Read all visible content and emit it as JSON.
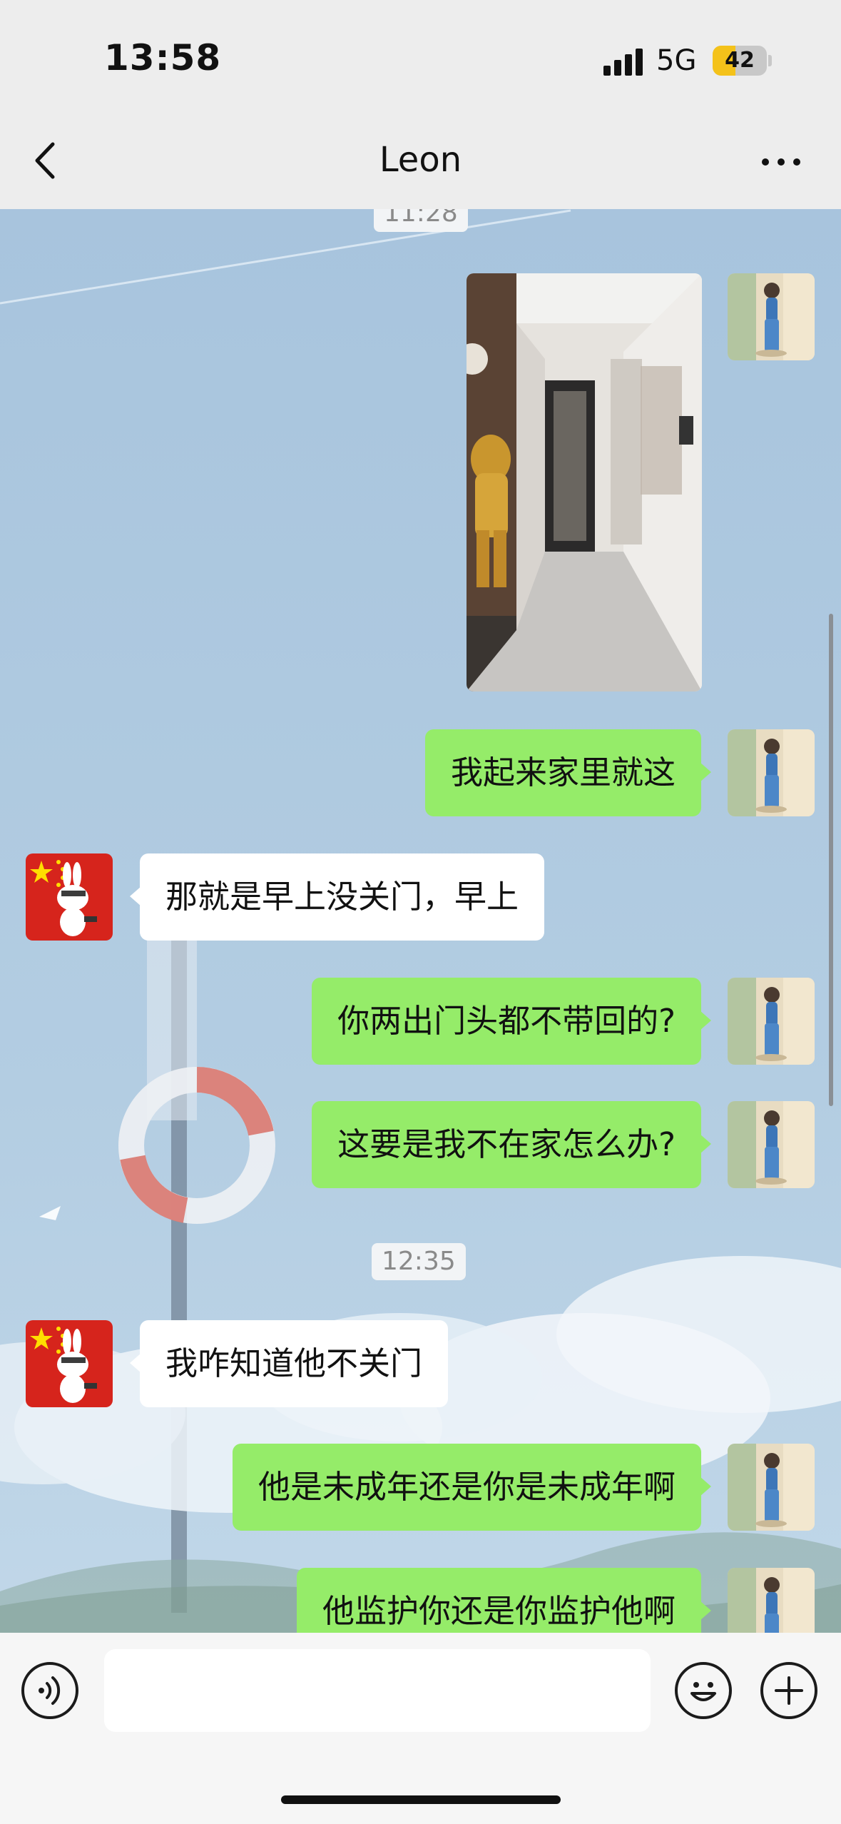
{
  "status_bar": {
    "time": "13:58",
    "network": "5G",
    "battery": "42",
    "battery_level": 0.42,
    "battery_color": "#f4c21a"
  },
  "nav": {
    "title": "Leon",
    "back_icon": "chevron-left-icon",
    "more_icon": "more-horizontal-icon"
  },
  "messages": [
    {
      "type": "timestamp",
      "text": "11:28"
    },
    {
      "type": "image",
      "sender": "me"
    },
    {
      "type": "text",
      "sender": "me",
      "text": "我起来家里就这"
    },
    {
      "type": "text",
      "sender": "other",
      "text": "那就是早上没关门，早上"
    },
    {
      "type": "text",
      "sender": "me",
      "text": "你两出门头都不带回的?"
    },
    {
      "type": "text",
      "sender": "me",
      "text": "这要是我不在家怎么办?"
    },
    {
      "type": "timestamp",
      "text": "12:35"
    },
    {
      "type": "text",
      "sender": "other",
      "text": "我咋知道他不关门"
    },
    {
      "type": "text",
      "sender": "me",
      "text": "他是未成年还是你是未成年啊"
    },
    {
      "type": "text",
      "sender": "me",
      "text": "他监护你还是你监护他啊"
    }
  ],
  "input_bar": {
    "voice_icon": "voice-icon",
    "emoji_icon": "emoji-icon",
    "plus_icon": "plus-icon",
    "input_value": ""
  },
  "colors": {
    "my_bubble": "#95ec69",
    "other_bubble": "#ffffff",
    "nav_bg": "#ededed"
  }
}
